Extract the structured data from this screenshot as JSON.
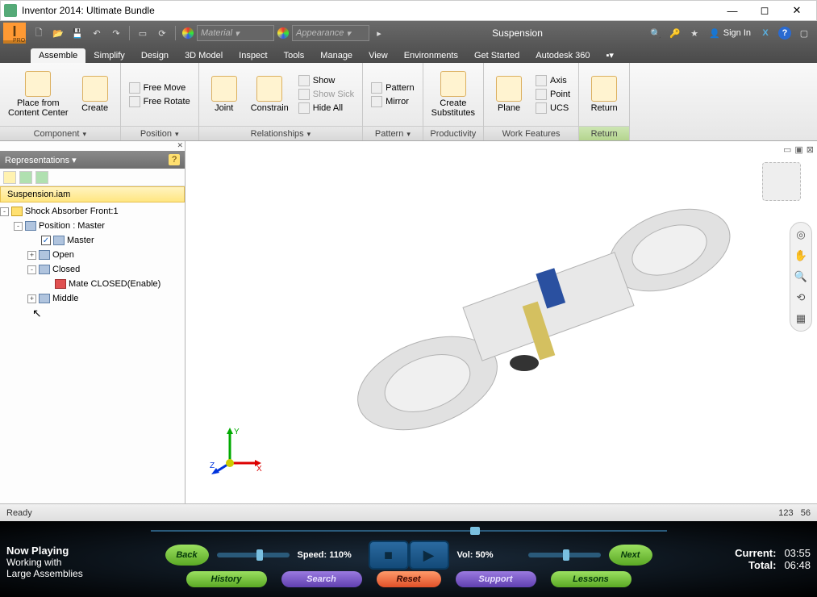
{
  "window": {
    "title": "Inventor 2014: Ultimate Bundle",
    "min": "—",
    "max": "◻",
    "close": "✕"
  },
  "qat": {
    "material_placeholder": "Material",
    "appearance_placeholder": "Appearance",
    "doc_title": "Suspension",
    "signin": "Sign In"
  },
  "tabs": {
    "items": [
      "Assemble",
      "Simplify",
      "Design",
      "3D Model",
      "Inspect",
      "Tools",
      "Manage",
      "View",
      "Environments",
      "Get Started",
      "Autodesk 360"
    ],
    "active": 0
  },
  "ribbon": {
    "groups": [
      {
        "label": "Component",
        "dd": true,
        "big": [
          {
            "t": "Place from\nContent Center"
          },
          {
            "t": "Create"
          }
        ],
        "small": []
      },
      {
        "label": "Position",
        "dd": true,
        "big": [],
        "small": [
          {
            "t": "Free Move"
          },
          {
            "t": "Free Rotate"
          }
        ]
      },
      {
        "label": "Relationships",
        "dd": true,
        "big": [
          {
            "t": "Joint"
          },
          {
            "t": "Constrain"
          }
        ],
        "small": [
          {
            "t": "Show"
          },
          {
            "t": "Show Sick",
            "disabled": true
          },
          {
            "t": "Hide All"
          }
        ]
      },
      {
        "label": "Pattern",
        "dd": true,
        "big": [],
        "small": [
          {
            "t": "Pattern"
          },
          {
            "t": "Mirror"
          }
        ]
      },
      {
        "label": "Productivity",
        "dd": false,
        "big": [
          {
            "t": "Create\nSubstitutes"
          }
        ],
        "small": []
      },
      {
        "label": "Work Features",
        "dd": false,
        "big": [
          {
            "t": "Plane"
          }
        ],
        "small": [
          {
            "t": "Axis"
          },
          {
            "t": "Point"
          },
          {
            "t": "UCS"
          }
        ]
      },
      {
        "label": "Return",
        "dd": false,
        "highlight": true,
        "big": [
          {
            "t": "Return"
          }
        ],
        "small": []
      }
    ]
  },
  "browser": {
    "panel_title": "Representations",
    "root": "Suspension.iam",
    "tree": [
      {
        "depth": 0,
        "exp": "-",
        "icon": "yel",
        "label": "Shock Absorber Front:1"
      },
      {
        "depth": 1,
        "exp": "-",
        "icon": "blue",
        "label": "Position : Master"
      },
      {
        "depth": 2,
        "exp": "",
        "icon": "blue",
        "chk": true,
        "label": "Master"
      },
      {
        "depth": 2,
        "exp": "+",
        "icon": "blue",
        "label": "Open"
      },
      {
        "depth": 2,
        "exp": "-",
        "icon": "blue",
        "label": "Closed"
      },
      {
        "depth": 3,
        "exp": "",
        "icon": "red",
        "label": "Mate CLOSED(Enable)"
      },
      {
        "depth": 2,
        "exp": "+",
        "icon": "blue",
        "label": "Middle"
      }
    ]
  },
  "status": {
    "ready": "Ready",
    "n1": "123",
    "n2": "56"
  },
  "player": {
    "now_playing_title": "Now Playing",
    "now_playing_line1": "Working with",
    "now_playing_line2": "Large Assemblies",
    "back": "Back",
    "next": "Next",
    "speed_label": "Speed:",
    "speed_value": "110%",
    "vol_label": "Vol:",
    "vol_value": "50%",
    "history": "History",
    "search": "Search",
    "reset": "Reset",
    "support": "Support",
    "lessons": "Lessons",
    "current_label": "Current:",
    "current_value": "03:55",
    "total_label": "Total:",
    "total_value": "06:48"
  }
}
